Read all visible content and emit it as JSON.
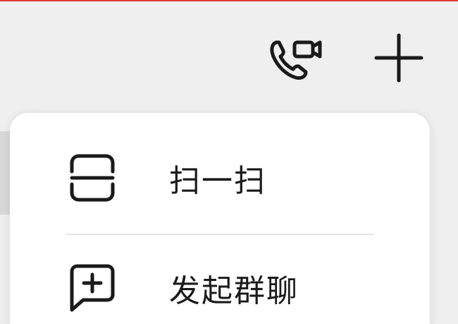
{
  "colors": {
    "accent_red": "#e53935",
    "background": "#efefef",
    "menu_background": "#ffffff",
    "foreground": "#1a1a1a",
    "divider": "#e4e4e4"
  },
  "toolbar": {
    "call_icon": "video-call-icon",
    "add_icon": "plus-icon"
  },
  "menu": {
    "items": [
      {
        "label": "扫一扫",
        "icon": "scan-icon"
      },
      {
        "label": "发起群聊",
        "icon": "group-chat-icon"
      }
    ]
  }
}
